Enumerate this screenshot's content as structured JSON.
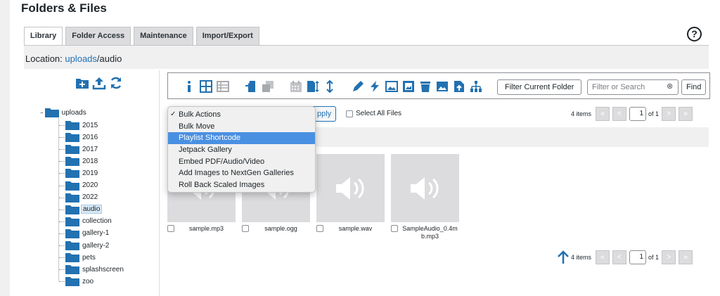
{
  "page_title": "Folders & Files",
  "help_icon": "?",
  "tabs": [
    {
      "label": "Library",
      "active": true
    },
    {
      "label": "Folder Access",
      "active": false
    },
    {
      "label": "Maintenance",
      "active": false
    },
    {
      "label": "Import/Export",
      "active": false
    }
  ],
  "location": {
    "prefix": "Location: ",
    "link": "uploads",
    "rest": "/audio"
  },
  "tree": {
    "root": "uploads",
    "children": [
      "2015",
      "2016",
      "2017",
      "2018",
      "2019",
      "2020",
      "2022",
      "audio",
      "collection",
      "gallery-1",
      "gallery-2",
      "pets",
      "splashscreen",
      "zoo"
    ],
    "selected": "audio"
  },
  "toolbar": {
    "filter_button": "Filter Current Folder",
    "search_placeholder": "Filter or Search",
    "find_button": "Find"
  },
  "bulk": {
    "apply_label": "pply",
    "select_all_label": "Select All Files",
    "options": [
      "Bulk Actions",
      "Bulk Move",
      "Playlist Shortcode",
      "Jetpack Gallery",
      "Embed PDF/Audio/Video",
      "Add Images to NextGen Galleries",
      "Roll Back Scaled Images"
    ],
    "selected_index": 0,
    "highlighted_index": 2
  },
  "pagination": {
    "count": "4 items",
    "first": "«",
    "prev": "<",
    "page": "1",
    "of": "of 1",
    "next": ">",
    "last": "»"
  },
  "files": [
    {
      "name": "sample.mp3"
    },
    {
      "name": "sample.ogg"
    },
    {
      "name": "sample.wav"
    },
    {
      "name": "SampleAudio_0.4mb.mp3",
      "display": [
        "SampleAudio_0.4m",
        "b.mp3"
      ]
    }
  ],
  "colors": {
    "accent": "#2271b1",
    "highlight": "#4a90e2",
    "thumb_bg": "#dcdcde"
  }
}
